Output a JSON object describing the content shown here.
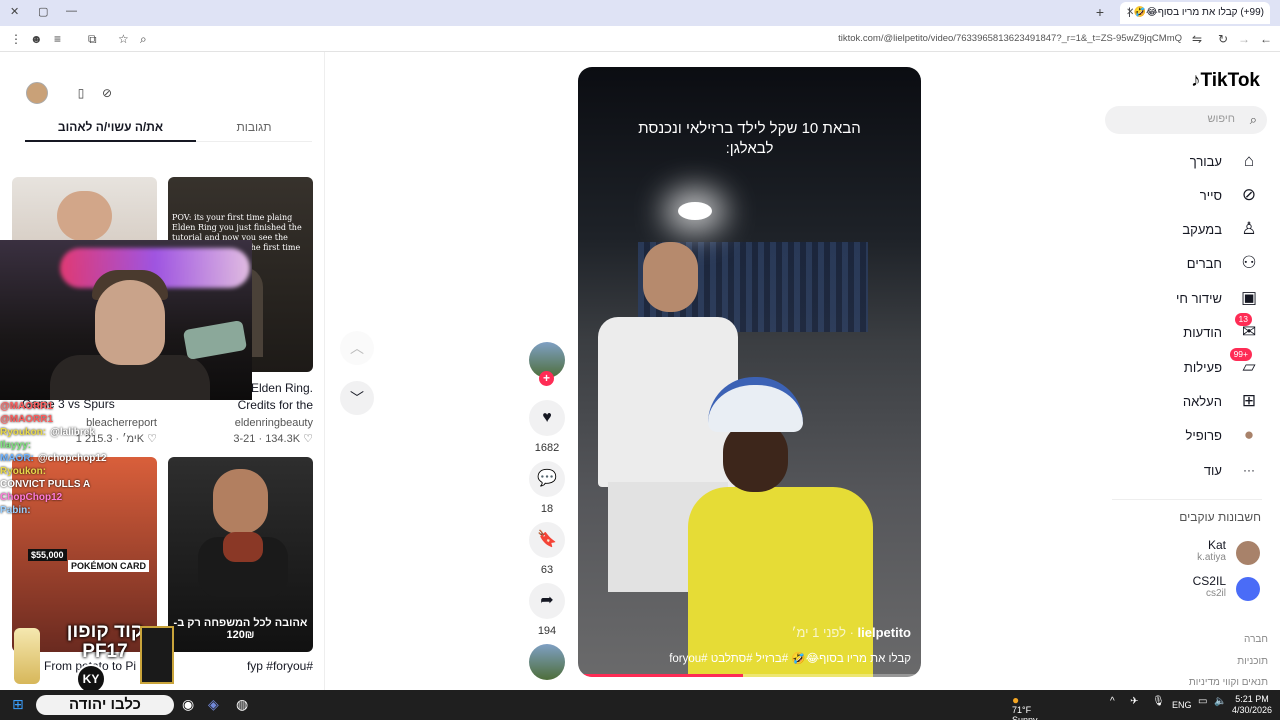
{
  "browser": {
    "tab_title": "(99+) קבלו את מריו בסוף😂🤣 |",
    "url": "tiktok.com/@lielpetito/video/7633965813623491847?_r=1&_t=ZS-95wZ9jqCMmQ"
  },
  "left_panel": {
    "tabs": [
      "את/ה עשוי/ה לאהוב",
      "תגובות"
    ],
    "videos": [
      {
        "caption": "...Game 3 vs Spurs",
        "author": "bleacherreport",
        "date": "1 ימ׳",
        "likes": "215.3K"
      },
      {
        "caption": "...of the Elden Ring. Credits for the",
        "author": "eldenringbeauty",
        "date": "3-21",
        "likes": "134.3K"
      },
      {
        "caption": "From potato to Pi",
        "author": "",
        "date": "",
        "likes": ""
      },
      {
        "caption": "fyp #foryou#",
        "author": "",
        "date": "",
        "likes": ""
      }
    ],
    "thumb2_text": "POV: its your first time plaing Elden Ring you just finished the tutorial and now you see the lands between for the first time",
    "thumb3_overlay": [
      "$55,000",
      "POKÉMON CARD"
    ],
    "thumb4_overlay": "אהובה לכל המשפחה רק ב- 120₪"
  },
  "stream_overlay": {
    "chat": [
      {
        "user": "@MAORR1",
        "text": "",
        "color": "#ff5c5c"
      },
      {
        "user": "@MAORR1",
        "text": "",
        "color": "#ff5c5c"
      },
      {
        "user": "Ryoukon:",
        "text": "@lalibrek",
        "color": "#e8d94a"
      },
      {
        "user": "Ilayyy:",
        "text": "",
        "color": "#7de37d"
      },
      {
        "user": "MAOR:",
        "text": "@chopchop12",
        "color": "#6fb3ff"
      },
      {
        "user": "Ryoukon:",
        "text": "",
        "color": "#e8d94a"
      },
      {
        "user": "CONVICT PULLS A",
        "text": "",
        "color": "#ffffff"
      },
      {
        "user": "ChopChop12",
        "text": "",
        "color": "#ff7ad9"
      },
      {
        "user": "Pabin:",
        "text": "",
        "color": "#9ad0ff"
      }
    ],
    "promo_code": "קוד קופון PF17",
    "brand_badge": "KY",
    "taskbar_banner": "כלבו יהודה"
  },
  "video": {
    "caption_overlay": "הבאת 10 שקל לילד ברזילאי ונכנסת לבאלגן:",
    "author": "lielpetito",
    "posted": "לפני 1 ימ׳",
    "description": "קבלו את מריו בסוף😂🤣 #ברזיל #סתלבט #foryou",
    "progress": 0.48
  },
  "actions": {
    "likes": "1682",
    "comments": "18",
    "saves": "63",
    "shares": "194"
  },
  "sidebar": {
    "logo": "TikTok",
    "search_placeholder": "חיפוש",
    "nav": [
      {
        "label": "עבורך",
        "icon": "home-icon"
      },
      {
        "label": "סייר",
        "icon": "compass-icon"
      },
      {
        "label": "במעקב",
        "icon": "following-icon"
      },
      {
        "label": "חברים",
        "icon": "friends-icon"
      },
      {
        "label": "שידור חי",
        "icon": "live-icon"
      },
      {
        "label": "הודעות",
        "icon": "messages-icon",
        "badge": "13"
      },
      {
        "label": "פעילות",
        "icon": "activity-icon",
        "badge": "99+"
      },
      {
        "label": "העלאה",
        "icon": "upload-icon"
      },
      {
        "label": "פרופיל",
        "icon": "profile-icon"
      },
      {
        "label": "עוד",
        "icon": "more-icon"
      }
    ],
    "following_title": "חשבונות עוקבים",
    "following": [
      {
        "name": "Kat",
        "handle": "k.atiya"
      },
      {
        "name": "CS2IL",
        "handle": "cs2il"
      }
    ],
    "footer": [
      "חברה",
      "תוכניות",
      "תנאים וקווי מדיניות"
    ]
  },
  "taskbar": {
    "weather_temp": "71°F",
    "weather_desc": "Sunny",
    "lang": "ENG",
    "time": "5:21 PM",
    "date": "4/30/2026"
  },
  "colors": {
    "accent": "#fe2c55",
    "text": "#161823"
  }
}
